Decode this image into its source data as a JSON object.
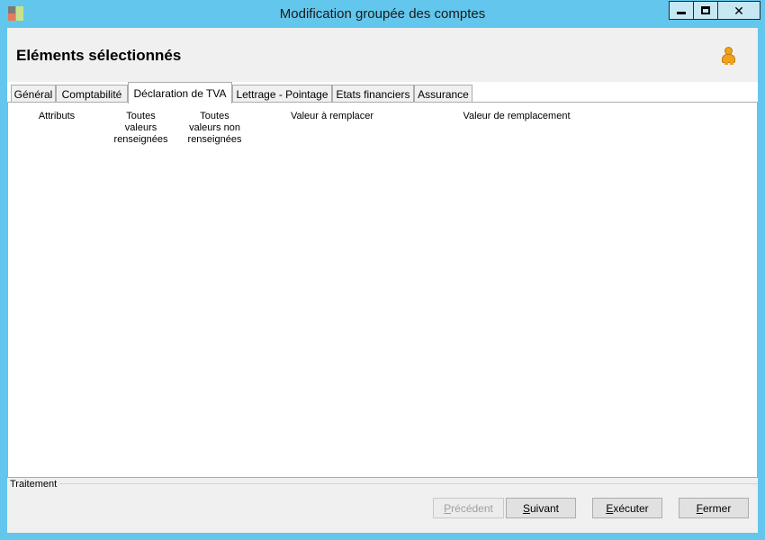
{
  "window": {
    "title": "Modification groupée des comptes",
    "minimize": "minimize",
    "maximize": "maximize",
    "close": "✕"
  },
  "header": {
    "title": "Eléments sélectionnés"
  },
  "tabs": [
    {
      "label": "Général"
    },
    {
      "label": "Comptabilité"
    },
    {
      "label": "Déclaration de TVA",
      "active": true
    },
    {
      "label": "Lettrage - Pointage"
    },
    {
      "label": "Etats financiers"
    },
    {
      "label": "Assurance"
    }
  ],
  "grid": {
    "columns": [
      {
        "label": "Attributs"
      },
      {
        "label": "Toutes\nvaleurs\nrenseignées"
      },
      {
        "label": "Toutes\nvaleurs non\nrenseignées"
      },
      {
        "label": "Valeur à remplacer"
      },
      {
        "label": "Valeur de remplacement"
      }
    ]
  },
  "treatment": {
    "label": "Traitement"
  },
  "buttons": {
    "previous": {
      "first": "P",
      "rest": "récédent"
    },
    "next": {
      "first": "S",
      "rest": "uivant"
    },
    "execute": {
      "first": "E",
      "rest": "xécuter"
    },
    "close": {
      "first": "F",
      "rest": "ermer"
    }
  },
  "colors": {
    "frame": "#63c6ec",
    "user_icon": "#f0a21c"
  }
}
